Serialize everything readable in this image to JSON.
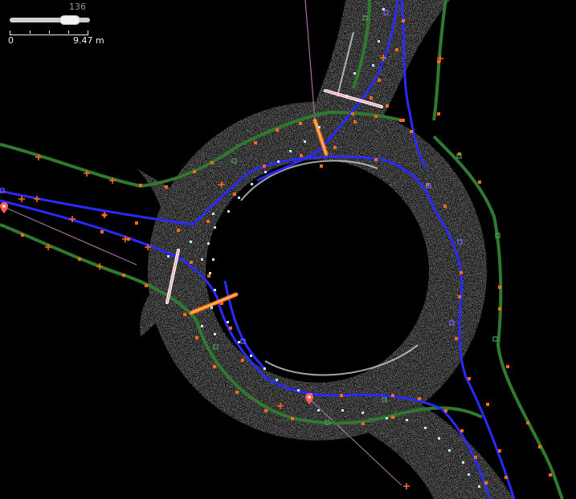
{
  "map": {
    "zoom_level": "136",
    "scale_start": "0",
    "scale_end": "9.47 m"
  },
  "colors": {
    "background": "#000000",
    "point_cloud": "#cfcfcf",
    "lane_centerline": "#2a2aff",
    "road_edge": "#2f7a2f",
    "vertex": "#ff6a1a",
    "marker": "#ff5a5a"
  },
  "icons": [
    "map-pin-icon"
  ]
}
